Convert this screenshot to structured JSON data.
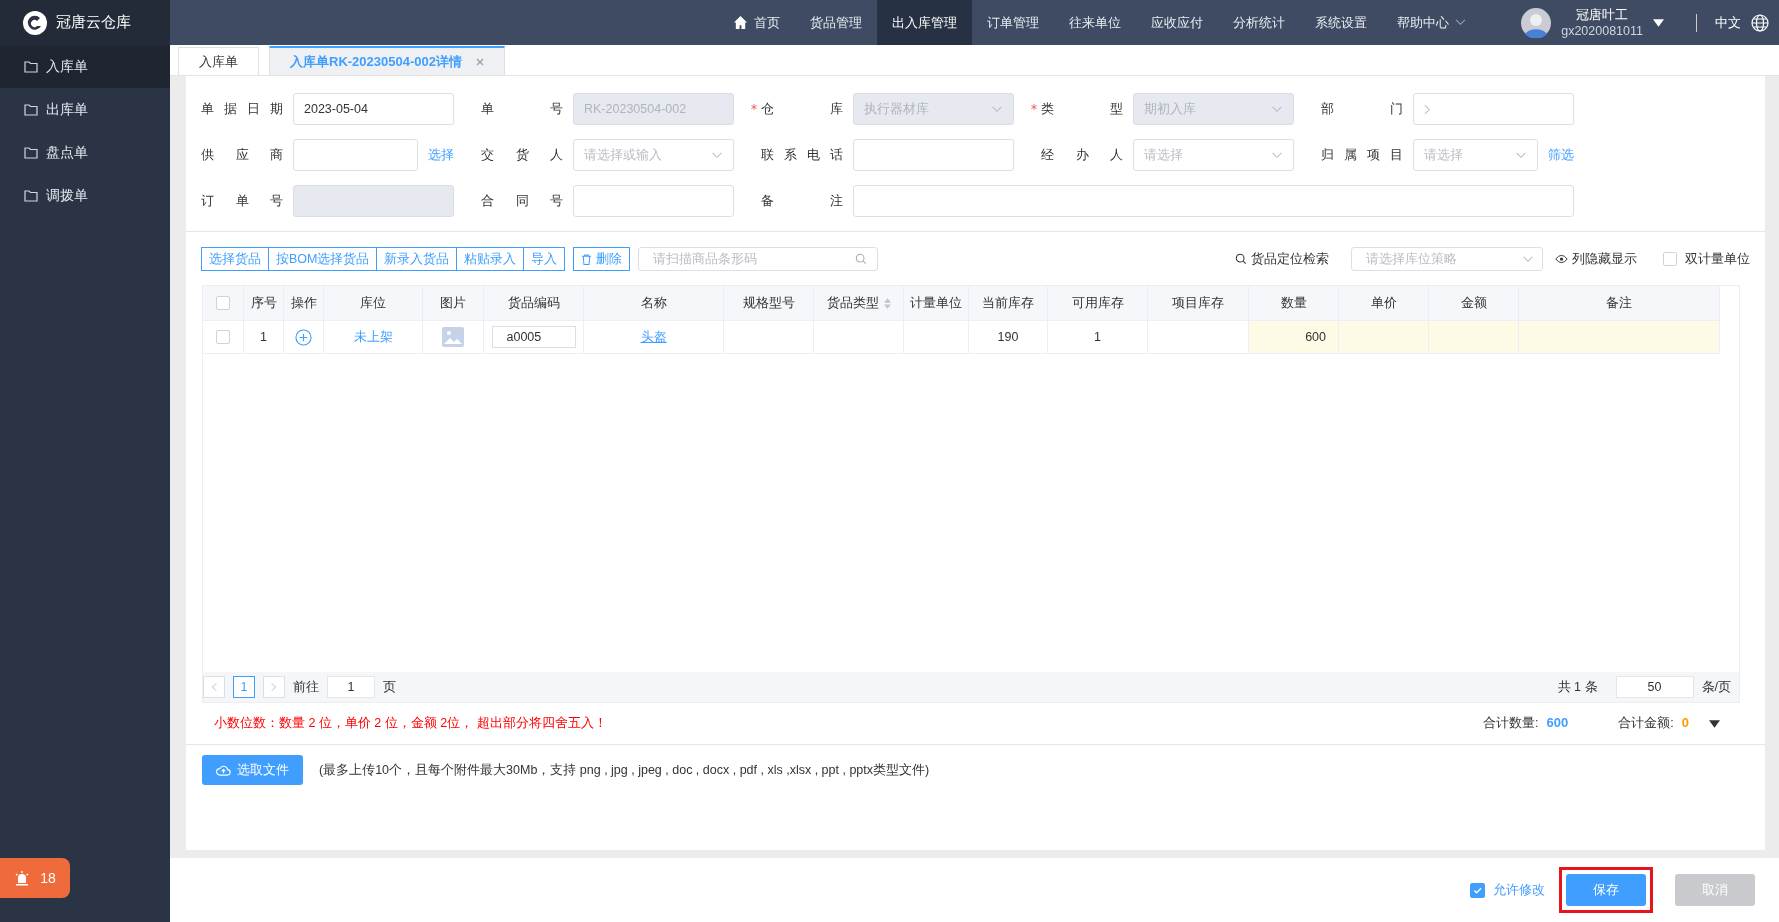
{
  "app": {
    "name": "冠唐云仓库"
  },
  "nav": [
    {
      "label": "首页",
      "kind": "home",
      "selected": false
    },
    {
      "label": "货品管理",
      "kind": "plain",
      "selected": false
    },
    {
      "label": "出入库管理",
      "kind": "plain",
      "selected": true
    },
    {
      "label": "订单管理",
      "kind": "plain",
      "selected": false
    },
    {
      "label": "往来单位",
      "kind": "plain",
      "selected": false
    },
    {
      "label": "应收应付",
      "kind": "plain",
      "selected": false
    },
    {
      "label": "分析统计",
      "kind": "plain",
      "selected": false
    },
    {
      "label": "系统设置",
      "kind": "plain",
      "selected": false
    },
    {
      "label": "帮助中心",
      "kind": "dropdown",
      "selected": false
    }
  ],
  "user": {
    "name": "冠唐叶工",
    "id": "gx2020081011"
  },
  "language": "中文",
  "sidebar": {
    "items": [
      {
        "label": "入库单",
        "selected": true
      },
      {
        "label": "出库单",
        "selected": false
      },
      {
        "label": "盘点单",
        "selected": false
      },
      {
        "label": "调拨单",
        "selected": false
      }
    ]
  },
  "alert_badge": {
    "count": "18"
  },
  "page_tabs": [
    {
      "label": "入库单",
      "selected": false,
      "closable": false
    },
    {
      "label": "入库单RK-20230504-002详情",
      "selected": true,
      "closable": true
    }
  ],
  "form": {
    "fields": [
      {
        "label": "单据日期",
        "required": false,
        "kind": "input",
        "disabled": false,
        "value": "2023-05-04"
      },
      {
        "label": "单号",
        "required": false,
        "kind": "input",
        "disabled": true,
        "value": "RK-20230504-002"
      },
      {
        "label": "仓库",
        "required": true,
        "kind": "select",
        "disabled": true,
        "value": "执行器材库"
      },
      {
        "label": "类型",
        "required": true,
        "kind": "select",
        "disabled": true,
        "value": "期初入库"
      },
      {
        "label": "部门",
        "required": false,
        "kind": "cascade",
        "disabled": false
      },
      {
        "label": "供应商",
        "required": false,
        "kind": "input",
        "disabled": false,
        "link": "选择"
      },
      {
        "label": "交货人",
        "required": false,
        "kind": "select",
        "disabled": false,
        "placeholder": "请选择或输入"
      },
      {
        "label": "联系电话",
        "required": false,
        "kind": "input",
        "disabled": false
      },
      {
        "label": "经办人",
        "required": false,
        "kind": "select",
        "disabled": false,
        "placeholder": "请选择"
      },
      {
        "label": "归属项目",
        "required": false,
        "kind": "select",
        "disabled": false,
        "placeholder": "请选择",
        "link": "筛选"
      },
      {
        "label": "订单号",
        "required": false,
        "kind": "input",
        "disabled": true
      },
      {
        "label": "合同号",
        "required": false,
        "kind": "input",
        "disabled": false
      },
      {
        "label": "备注",
        "required": false,
        "kind": "long",
        "disabled": false
      }
    ]
  },
  "toolbar": {
    "buttons": [
      "选择货品",
      "按BOM选择货品",
      "新录入货品",
      "粘贴录入",
      "导入"
    ],
    "delete_button": "删除",
    "barcode_search": {
      "placeholder": "请扫描商品条形码"
    },
    "locate_search": "货品定位检索",
    "location_strategy": {
      "placeholder": "请选择库位策略"
    },
    "column_toggle": "列隐藏显示",
    "dual_unit": {
      "label": "双计量单位",
      "checked": false
    }
  },
  "table": {
    "all_selected": false,
    "columns": [
      {
        "label": "序号",
        "kind": "text",
        "sortable": false,
        "editable": false
      },
      {
        "label": "操作",
        "kind": "action",
        "sortable": false,
        "editable": false
      },
      {
        "label": "库位",
        "kind": "location",
        "sortable": false,
        "editable": false
      },
      {
        "label": "图片",
        "kind": "image",
        "sortable": false,
        "editable": false
      },
      {
        "label": "货品编码",
        "kind": "code",
        "sortable": false,
        "editable": false
      },
      {
        "label": "名称",
        "kind": "name",
        "sortable": false,
        "editable": false
      },
      {
        "label": "规格型号",
        "kind": "text",
        "sortable": false,
        "editable": false
      },
      {
        "label": "货品类型",
        "kind": "text",
        "sortable": true,
        "editable": false
      },
      {
        "label": "计量单位",
        "kind": "text",
        "sortable": false,
        "editable": false
      },
      {
        "label": "当前库存",
        "kind": "text",
        "sortable": false,
        "editable": false
      },
      {
        "label": "可用库存",
        "kind": "text",
        "sortable": false,
        "editable": false
      },
      {
        "label": "项目库存",
        "kind": "text",
        "sortable": false,
        "editable": false
      },
      {
        "label": "数量",
        "kind": "number",
        "sortable": false,
        "editable": true
      },
      {
        "label": "单价",
        "kind": "number",
        "sortable": false,
        "editable": true
      },
      {
        "label": "金额",
        "kind": "number",
        "sortable": false,
        "editable": true
      },
      {
        "label": "备注",
        "kind": "text",
        "sortable": false,
        "editable": true
      }
    ],
    "rows": [
      {
        "selected": false,
        "cells": [
          "1",
          null,
          "未上架",
          null,
          "a0005",
          "头盔",
          null,
          null,
          null,
          "190",
          "1",
          null,
          "600",
          null,
          null,
          null
        ]
      }
    ]
  },
  "pagination": {
    "page": "1",
    "goto_label": "前往",
    "goto_value": "1",
    "goto_unit": "页",
    "total": "共 1 条",
    "page_size": "50",
    "size_unit": "条/页"
  },
  "notice": "小数位数：数量 2 位，单价 2 位，金额 2位， 超出部分将四舍五入！",
  "totals": [
    {
      "label": "合计数量:",
      "value": "600",
      "color": "#409eff"
    },
    {
      "label": "合计金额:",
      "value": "0",
      "color": "#ff9900"
    }
  ],
  "upload": {
    "button": "选取文件",
    "hint": "(最多上传10个，且每个附件最大30Mb，支持 png , jpg , jpeg , doc , docx , pdf , xls ,xlsx , ppt , pptx类型文件)"
  },
  "footer": {
    "allow_edit": {
      "label": "允许修改",
      "checked": true
    },
    "save": {
      "label": "保存",
      "highlighted": true
    },
    "cancel": {
      "label": "取消",
      "disabled": true
    }
  }
}
